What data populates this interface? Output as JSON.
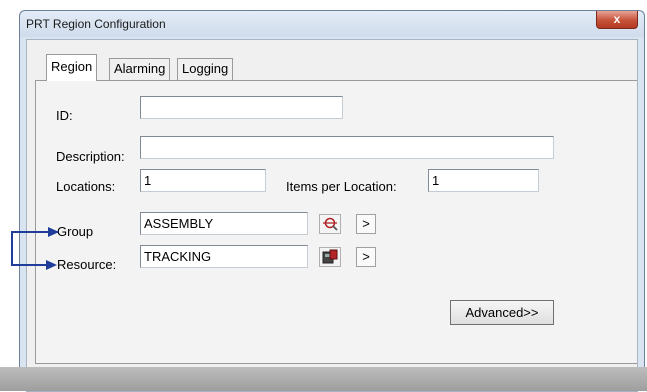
{
  "window": {
    "title": "PRT Region Configuration",
    "close_symbol": "x"
  },
  "tabs": [
    {
      "label": "Region",
      "active": true
    },
    {
      "label": "Alarming",
      "active": false
    },
    {
      "label": "Logging",
      "active": false
    }
  ],
  "form": {
    "id_label": "ID:",
    "id_value": "",
    "description_label": "Description:",
    "description_value": "",
    "locations_label": "Locations:",
    "locations_value": "1",
    "items_per_location_label": "Items per Location:",
    "items_per_location_value": "1",
    "group_label": "Group",
    "group_value": "ASSEMBLY",
    "resource_label": "Resource:",
    "resource_value": "TRACKING",
    "next_symbol": ">",
    "advanced_label": "Advanced>>"
  },
  "icons": {
    "group_lookup": "magnifier-icon",
    "resource_lookup": "resource-icon"
  },
  "colors": {
    "annotation_arrow": "#1f3d99",
    "close_button": "#c7523a"
  }
}
